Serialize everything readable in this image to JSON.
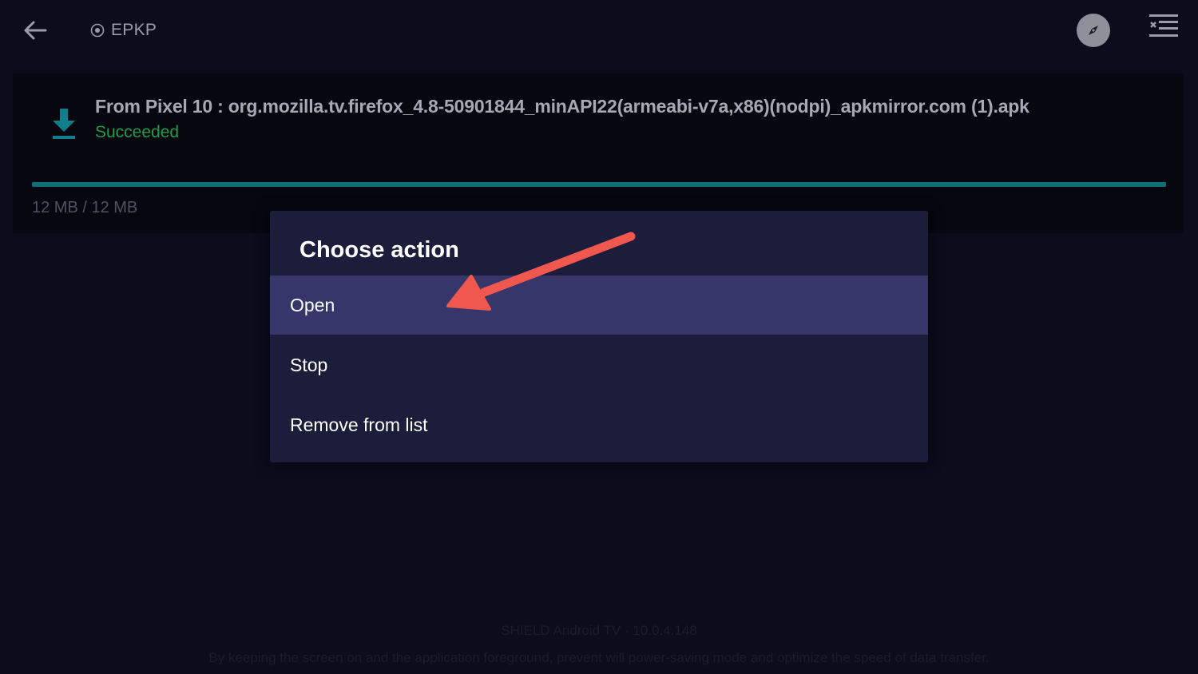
{
  "topbar": {
    "brand_label": "EPKP"
  },
  "download": {
    "title": "From Pixel 10 : org.mozilla.tv.firefox_4.8-50901844_minAPI22(armeabi-v7a,x86)(nodpi)_apkmirror.com (1).apk",
    "status": "Succeeded",
    "size": "12 MB / 12 MB",
    "progress_percent": 100
  },
  "dialog": {
    "title": "Choose action",
    "items": [
      {
        "label": "Open",
        "selected": true
      },
      {
        "label": "Stop",
        "selected": false
      },
      {
        "label": "Remove from list",
        "selected": false
      }
    ]
  },
  "footer": {
    "line1": "SHIELD Android TV · 10.0.4.148",
    "line2": "By keeping the screen on and the application foreground, prevent will power-saving mode and optimize the speed of data transfer."
  },
  "colors": {
    "background": "#0b0c1c",
    "dialog": "#1c1d3a",
    "selected_item": "#36366b",
    "status_green": "#1d9c4a",
    "progress": "#0f6f78",
    "arrow": "#f0584f"
  },
  "icons": {
    "back": "arrow-left-icon",
    "brand": "target-icon",
    "compass": "compass-icon",
    "menu": "menu-close-icon",
    "download": "download-icon"
  }
}
